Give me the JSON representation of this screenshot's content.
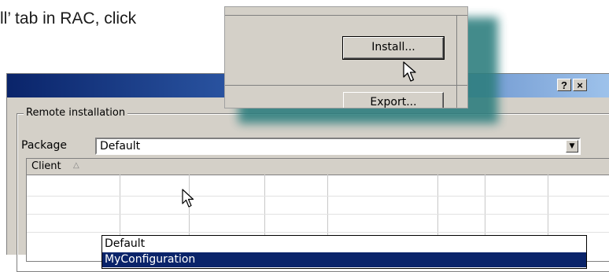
{
  "instruction": {
    "text": "ll’ tab in RAC, click"
  },
  "dialog": {
    "help_button": "?",
    "close_button": "×",
    "group_label": "Remote installation",
    "package_label": "Package",
    "package_value": "Default",
    "combo_arrow": "▼",
    "grid": {
      "column_client": "Client",
      "sort_icon": "△"
    },
    "dropdown_options": [
      "Default",
      "MyConfiguration"
    ]
  },
  "callout": {
    "install_label": "Install...",
    "export_label": "Export..."
  },
  "colors": {
    "title_gradient_start": "#0a246a",
    "callout_shadow": "#2f7f7f",
    "selection": "#0a246a",
    "dialog_face": "#d4d0c8"
  }
}
